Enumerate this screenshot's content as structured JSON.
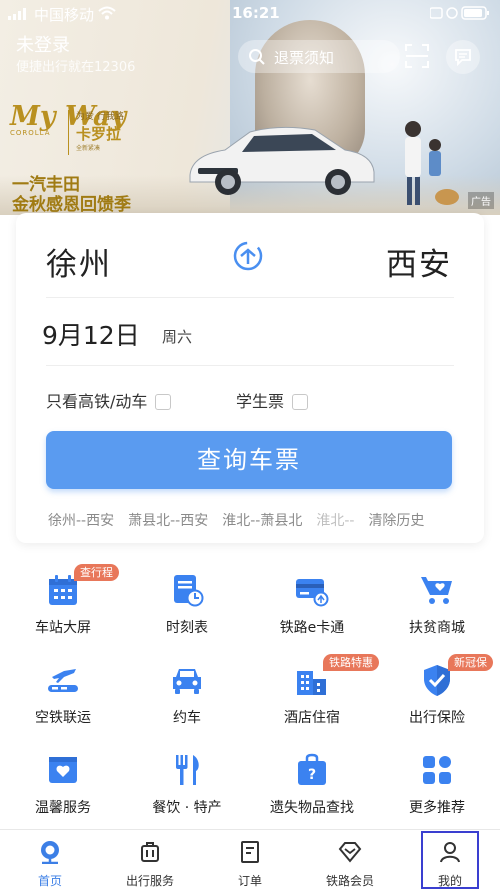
{
  "status": {
    "carrier": "中国移动",
    "time": "16:21"
  },
  "header": {
    "login": "未登录",
    "tagline": "便捷出行就在12306",
    "search_label": "退票须知"
  },
  "banner": {
    "brand_myway": "My Way",
    "brand_corolla": "COROLLA",
    "slogan": "为爱 行我路",
    "model": "卡罗拉",
    "model_sub": "全新紧凑",
    "faw_line1": "一汽丰田",
    "faw_line2": "金秋感恩回馈季",
    "ad_tag": "广告"
  },
  "ticket": {
    "from": "徐州",
    "to": "西安",
    "date": "9月12日",
    "weekday": "周六",
    "option_high_speed": "只看高铁/动车",
    "option_student": "学生票",
    "query_button": "查询车票",
    "history": [
      "徐州--西安",
      "萧县北--西安",
      "淮北--萧县北",
      "淮北--"
    ],
    "clear_history": "清除历史"
  },
  "services": [
    {
      "label": "车站大屏",
      "icon": "station-screen-icon",
      "badge": "查行程"
    },
    {
      "label": "时刻表",
      "icon": "timetable-icon",
      "badge": ""
    },
    {
      "label": "铁路e卡通",
      "icon": "ecard-icon",
      "badge": ""
    },
    {
      "label": "扶贫商城",
      "icon": "shopping-cart-icon",
      "badge": ""
    },
    {
      "label": "空铁联运",
      "icon": "plane-train-icon",
      "badge": ""
    },
    {
      "label": "约车",
      "icon": "car-icon",
      "badge": ""
    },
    {
      "label": "酒店住宿",
      "icon": "hotel-icon",
      "badge": "铁路特惠"
    },
    {
      "label": "出行保险",
      "icon": "insurance-shield-icon",
      "badge": "新冠保"
    },
    {
      "label": "温馨服务",
      "icon": "heart-box-icon",
      "badge": ""
    },
    {
      "label": "餐饮 · 特产",
      "icon": "dining-icon",
      "badge": ""
    },
    {
      "label": "遗失物品查找",
      "icon": "lost-found-icon",
      "badge": ""
    },
    {
      "label": "更多推荐",
      "icon": "more-grid-icon",
      "badge": ""
    }
  ],
  "tabs": [
    {
      "label": "首页",
      "icon": "home-icon"
    },
    {
      "label": "出行服务",
      "icon": "luggage-icon"
    },
    {
      "label": "订单",
      "icon": "order-icon"
    },
    {
      "label": "铁路会员",
      "icon": "diamond-icon"
    },
    {
      "label": "我的",
      "icon": "profile-icon"
    }
  ],
  "colors": {
    "primary": "#5a9bf0",
    "badge": "#e8775a",
    "active_tab": "#3c7fe6"
  }
}
